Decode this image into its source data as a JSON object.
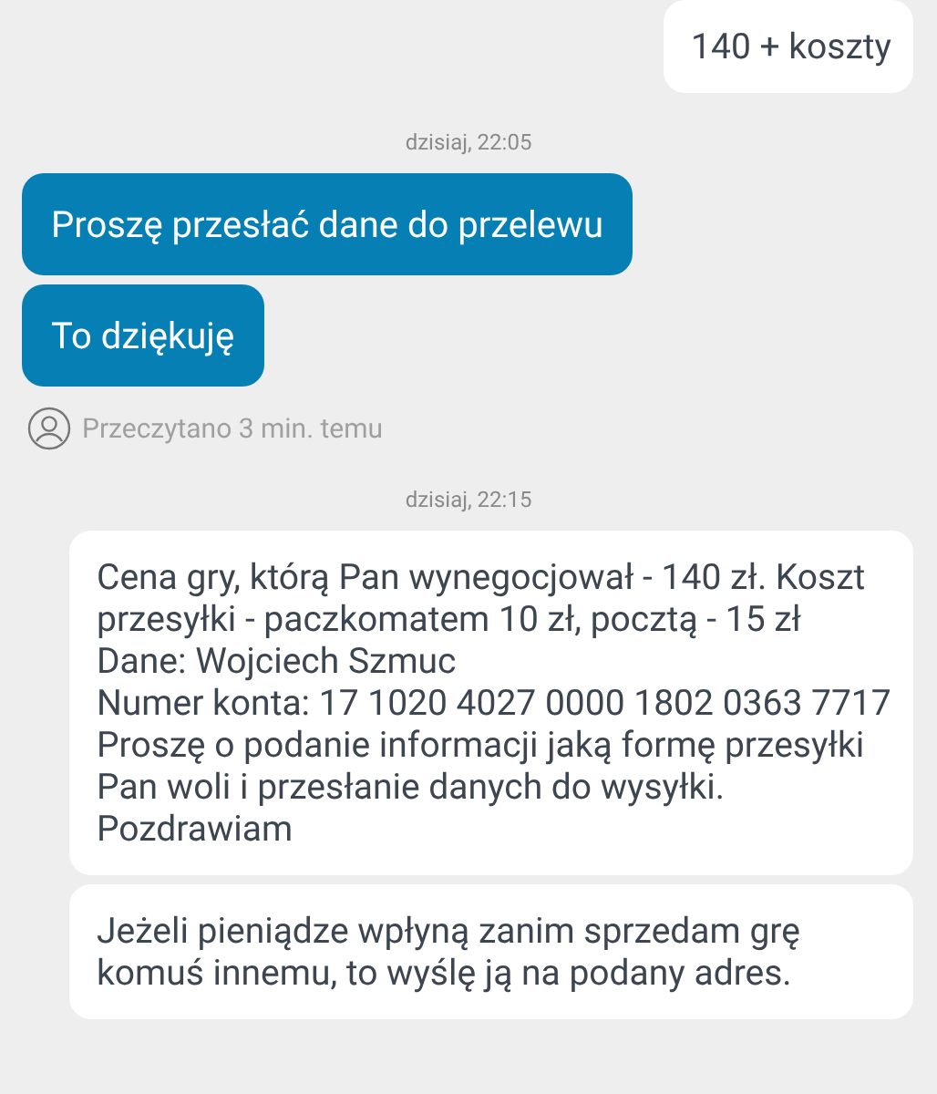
{
  "messages": [
    {
      "kind": "received",
      "text": "140 + koszty"
    },
    {
      "kind": "timestamp",
      "text": "dzisiaj, 22:05"
    },
    {
      "kind": "sent",
      "text": "Proszę przesłać dane do przelewu"
    },
    {
      "kind": "sent",
      "text": "To dziękuję"
    },
    {
      "kind": "read_receipt",
      "text": "Przeczytano 3 min. temu"
    },
    {
      "kind": "timestamp",
      "text": "dzisiaj, 22:15"
    },
    {
      "kind": "received",
      "text": "Cena gry, którą Pan wynegocjował - 140 zł. Koszt przesyłki - paczkomatem 10 zł, pocztą - 15 zł\nDane: Wojciech Szmuc\nNumer konta: 17 1020 4027 0000 1802 0363 7717\nProszę o podanie informacji jaką formę przesyłki Pan woli i przesłanie danych do wysyłki.\nPozdrawiam"
    },
    {
      "kind": "received",
      "text": "Jeżeli pieniądze wpłyną zanim sprzedam grę komuś innemu, to wyślę ją na podany adres."
    }
  ]
}
